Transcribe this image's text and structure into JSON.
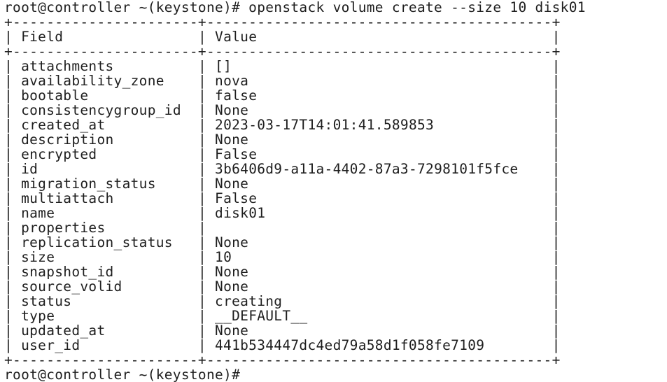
{
  "terminal": {
    "prompt": "root@controller ~(keystone)#",
    "command": "openstack volume create --size 10 disk01",
    "table": {
      "border_top": "+----------------------+-----------------------------------------+",
      "header_field": "Field",
      "header_value": "Value",
      "rows": [
        {
          "field": "attachments",
          "value": "[]"
        },
        {
          "field": "availability_zone",
          "value": "nova"
        },
        {
          "field": "bootable",
          "value": "false"
        },
        {
          "field": "consistencygroup_id",
          "value": "None"
        },
        {
          "field": "created_at",
          "value": "2023-03-17T14:01:41.589853"
        },
        {
          "field": "description",
          "value": "None"
        },
        {
          "field": "encrypted",
          "value": "False"
        },
        {
          "field": "id",
          "value": "3b6406d9-a11a-4402-87a3-7298101f5fce"
        },
        {
          "field": "migration_status",
          "value": "None"
        },
        {
          "field": "multiattach",
          "value": "False"
        },
        {
          "field": "name",
          "value": "disk01"
        },
        {
          "field": "properties",
          "value": ""
        },
        {
          "field": "replication_status",
          "value": "None"
        },
        {
          "field": "size",
          "value": "10"
        },
        {
          "field": "snapshot_id",
          "value": "None"
        },
        {
          "field": "source_volid",
          "value": "None"
        },
        {
          "field": "status",
          "value": "creating"
        },
        {
          "field": "type",
          "value": "__DEFAULT__"
        },
        {
          "field": "updated_at",
          "value": "None"
        },
        {
          "field": "user_id",
          "value": "441b534447dc4ed79a58d1f058fe7109"
        }
      ]
    },
    "final_prompt": "root@controller ~(keystone)#"
  }
}
